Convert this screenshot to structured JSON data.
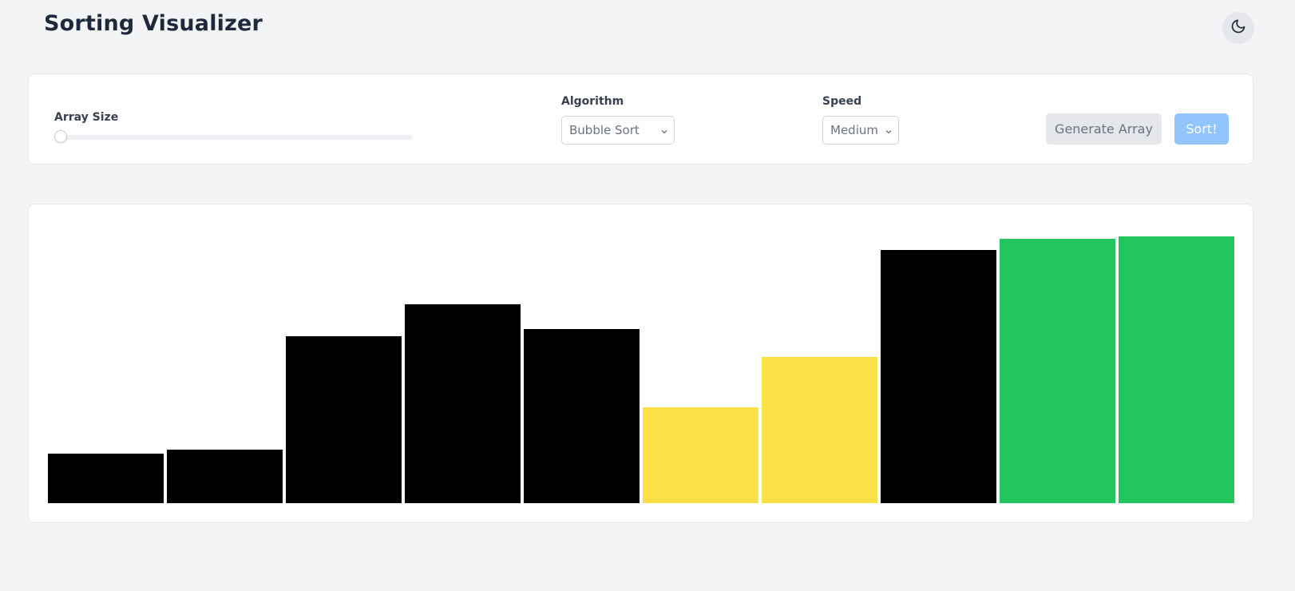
{
  "app": {
    "title": "Sorting Visualizer"
  },
  "theme_toggle": {
    "icon": "moon-icon"
  },
  "controls": {
    "array_size": {
      "label": "Array Size",
      "value_fraction": 0.0
    },
    "algorithm": {
      "label": "Algorithm",
      "selected": "Bubble Sort"
    },
    "speed": {
      "label": "Speed",
      "selected": "Medium"
    },
    "generate_label": "Generate Array",
    "sort_label": "Sort!"
  },
  "colors": {
    "default": "#000000",
    "comparing": "#fde047",
    "sorted": "#22c55e",
    "sort_button": "#93c5fd"
  },
  "bars": [
    {
      "value": 62,
      "state": "default"
    },
    {
      "value": 67,
      "state": "default"
    },
    {
      "value": 209,
      "state": "default"
    },
    {
      "value": 249,
      "state": "default"
    },
    {
      "value": 218,
      "state": "default"
    },
    {
      "value": 120,
      "state": "comparing"
    },
    {
      "value": 183,
      "state": "comparing"
    },
    {
      "value": 317,
      "state": "default"
    },
    {
      "value": 331,
      "state": "sorted"
    },
    {
      "value": 334,
      "state": "sorted"
    }
  ]
}
